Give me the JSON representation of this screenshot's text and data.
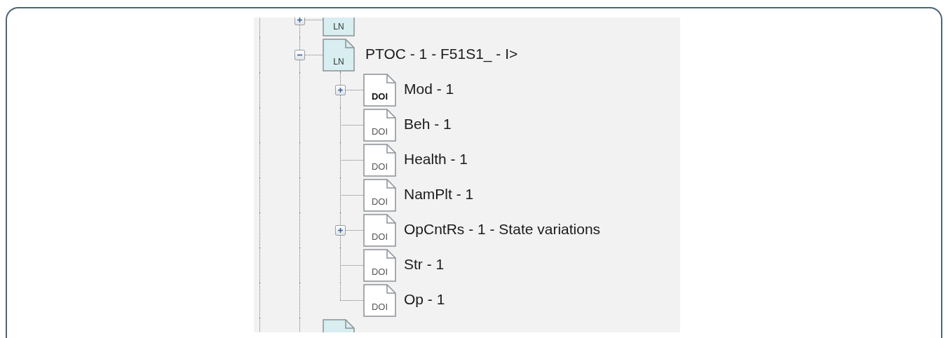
{
  "tree": {
    "nodes": [
      {
        "kind": "ln",
        "icon_label": "LN",
        "expanded": false
      },
      {
        "kind": "ln",
        "icon_label": "LN",
        "label": "PTOC - 1 - F51S1_ - I>",
        "expanded": true,
        "children": [
          {
            "kind": "doi",
            "icon_label": "DOI",
            "label": "Mod - 1",
            "expanded": false,
            "emphasized": true
          },
          {
            "kind": "doi",
            "icon_label": "DOI",
            "label": "Beh - 1",
            "emphasized": false
          },
          {
            "kind": "doi",
            "icon_label": "DOI",
            "label": "Health - 1",
            "emphasized": false
          },
          {
            "kind": "doi",
            "icon_label": "DOI",
            "label": "NamPlt - 1",
            "emphasized": false
          },
          {
            "kind": "doi",
            "icon_label": "DOI",
            "label": "OpCntRs - 1 - State variations",
            "expanded": false,
            "emphasized": false
          },
          {
            "kind": "doi",
            "icon_label": "DOI",
            "label": "Str - 1",
            "emphasized": false
          },
          {
            "kind": "doi",
            "icon_label": "DOI",
            "label": "Op - 1",
            "emphasized": false
          }
        ]
      },
      {
        "kind": "ln"
      }
    ]
  }
}
